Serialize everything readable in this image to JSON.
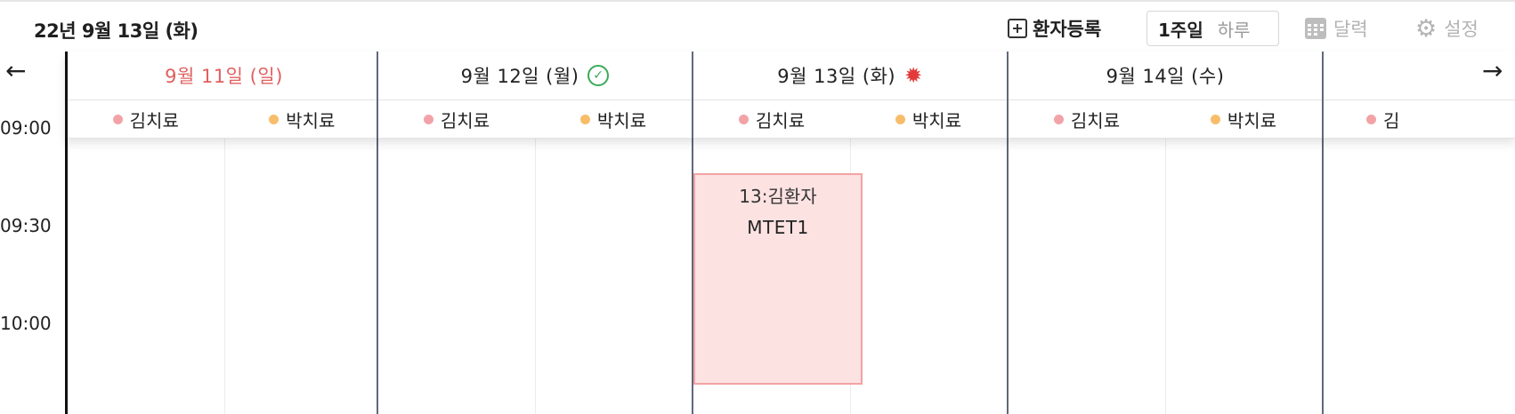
{
  "header": {
    "current_date": "22년 9월 13일 (화)",
    "register_label": "환자등록",
    "view_week_label": "1주일",
    "view_day_label": "하루",
    "calendar_label": "달력",
    "settings_label": "설정"
  },
  "nav": {
    "prev": "←",
    "next": "→"
  },
  "times": [
    "09:00",
    "09:30",
    "10:00"
  ],
  "days": [
    {
      "label": "9월 11일 (일)",
      "status": ""
    },
    {
      "label": "9월 12일 (월)",
      "status": "✓"
    },
    {
      "label": "9월 13일 (화)",
      "status": "✹"
    },
    {
      "label": "9월 14일 (수)",
      "status": ""
    }
  ],
  "therapists": [
    {
      "name": "김치료",
      "color": "#f2a3a8"
    },
    {
      "name": "박치료",
      "color": "#f7bd6a"
    }
  ],
  "partial_therapist": "김",
  "appointment": {
    "patient": "13:김환자",
    "treatment": "MTET1"
  },
  "colors": {
    "sunday": "#e06060",
    "appointment_bg": "#fde2e2",
    "appointment_border": "#f3a3a3",
    "status_ok": "#3aaa5a",
    "status_today": "#e23a3a"
  }
}
